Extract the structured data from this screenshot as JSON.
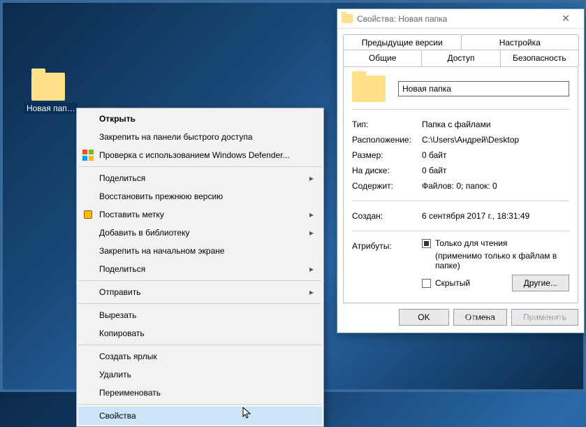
{
  "desktop": {
    "icon_label": "Новая пап…"
  },
  "context_menu": {
    "open": "Открыть",
    "pin_quick": "Закрепить на панели быстрого доступа",
    "defender": "Проверка с использованием Windows Defender...",
    "share": "Поделиться",
    "restore": "Восстановить прежнюю версию",
    "tag": "Поставить метку",
    "library": "Добавить в библиотеку",
    "pin_start": "Закрепить на начальном экране",
    "share2": "Поделиться",
    "send": "Отправить",
    "cut": "Вырезать",
    "copy": "Копировать",
    "shortcut": "Создать ярлык",
    "delete": "Удалить",
    "rename": "Переименовать",
    "properties": "Свойства"
  },
  "dialog": {
    "title": "Свойства: Новая папка",
    "tabs": {
      "prev": "Предыдущие версии",
      "settings": "Настройка",
      "general": "Общие",
      "access": "Доступ",
      "security": "Безопасность"
    },
    "name": "Новая папка",
    "type_k": "Тип:",
    "type_v": "Папка с файлами",
    "loc_k": "Расположение:",
    "loc_v": "C:\\Users\\Андрей\\Desktop",
    "size_k": "Размер:",
    "size_v": "0 байт",
    "disk_k": "На диске:",
    "disk_v": "0 байт",
    "contains_k": "Содержит:",
    "contains_v": "Файлов: 0; папок: 0",
    "created_k": "Создан:",
    "created_v": "6 сентября 2017 г., 18:31:49",
    "attr_k": "Атрибуты:",
    "readonly": "Только для чтения",
    "readonly_note": "(применимо только к файлам в папке)",
    "hidden": "Скрытый",
    "other_btn": "Другие...",
    "ok": "OK",
    "cancel": "Отмена",
    "apply": "Применить"
  },
  "watermark": "pcsecrets.ru"
}
